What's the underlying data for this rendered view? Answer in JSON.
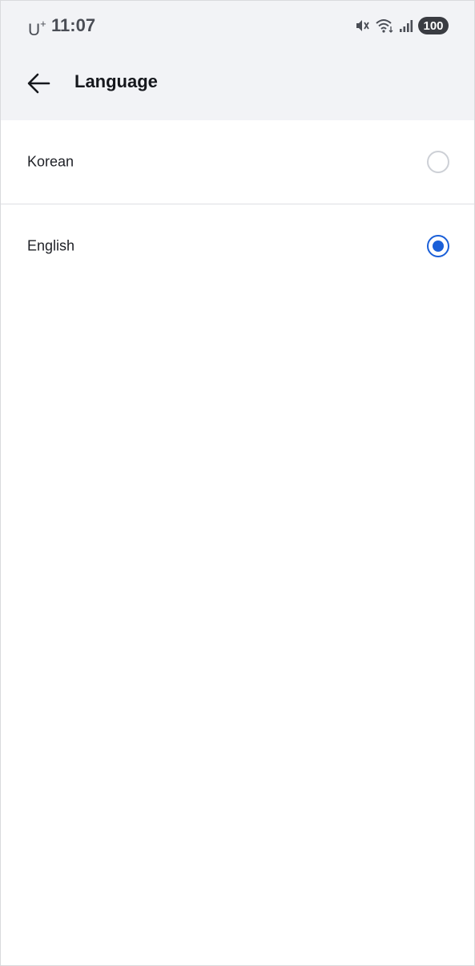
{
  "status_bar": {
    "carrier": "U",
    "carrier_superscript": "+",
    "time": "11:07",
    "icons": [
      "mute-icon",
      "wifi-icon",
      "signal-icon"
    ],
    "battery": "100"
  },
  "header": {
    "back_icon": "arrow-left-icon",
    "title": "Language"
  },
  "languages": [
    {
      "label": "Korean",
      "selected": false
    },
    {
      "label": "English",
      "selected": true
    }
  ],
  "colors": {
    "header_background": "#f2f3f6",
    "accent": "#1a5fd8",
    "radio_unselected": "#cdd0d6"
  }
}
